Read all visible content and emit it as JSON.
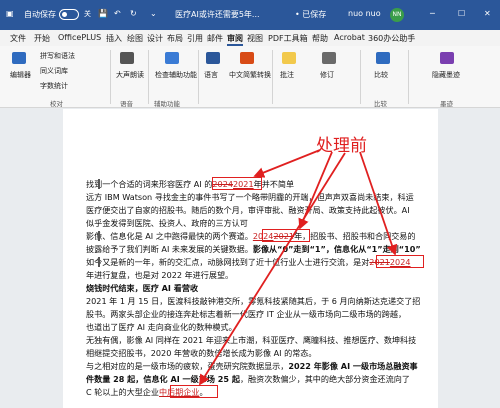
{
  "titlebar": {
    "autosave_label": "自动保存",
    "toggle_state": "关",
    "doc_title": "医疗AI或许还需要5年...",
    "saved_status": "• 已保存",
    "user_name": "nuo nuo",
    "user_initials": "NN"
  },
  "menu": [
    "文件",
    "开始",
    "OfficePLUS",
    "插入",
    "绘图",
    "设计",
    "布局",
    "引用",
    "邮件",
    "审阅",
    "视图",
    "PDF工具箱",
    "帮助",
    "Acrobat",
    "360办公助手"
  ],
  "ribbon": {
    "editor": "编辑器",
    "spelling": "拼写和语法",
    "synonyms": "同义词库",
    "wordcount": "字数统计",
    "proofing_group": "校对",
    "read_aloud": "大声朗读",
    "voice_group": "语音",
    "accessibility": "检查辅助功能",
    "accessibility_group": "辅助功能",
    "language": "语言",
    "chinese": "中文简繁转换",
    "comments": "批注",
    "tracking": "修订",
    "compare": "比较",
    "compare_group": "比较",
    "hide_ink": "隐藏墨迹",
    "ink_group": "墨迹"
  },
  "annotation": "处理前",
  "doc": {
    "l1a": "找到一个合适的词来形容医疗 AI 的",
    "l1_del": "2024",
    "l1_ins": "2021",
    "l1b": "年并不简单",
    "l2": "远方 IBM Watson 寻找金主的事件书写了一个略带阴霾的开端，但声声双喜尚未结束，科运",
    "l3": "医疗便交出了自家的招股书。随后的数个月，审评审批、融资开局、政策支持此起彼伏。AI",
    "l4": "似乎金发得到医院、投资人、政府的三方认可",
    "l5a": "影像、信息化是 AI 之中跑得最快的两个赛道。",
    "l5_ins": "2024",
    "l5_del": "2021",
    "l5b": "年，招股书、招股书和合同交易的",
    "l6a": "披露给予了我们判断 AI 未来发展的关键数据。",
    "l6b": "影像从“0”走到“1”，信息化从“1”走到“10”",
    "l7a": "如今又是新的一年，新的交汇点，动脉网找到了近十位行业人士进行交流，是对",
    "l7_del": "2021",
    "l7_ins": "2024",
    "l8": "年进行复盘，也是对 2022 年进行展望。",
    "l9": "烧钱时代结束，医疗 AI 看营收",
    "l10": "2021 年 1 月 15 日，医渡科技敲钟港交所，零氪科技紧随其后，于 6 月向纳斯达克递交了招",
    "l11": "股书。两家头部企业的接连奔赴标志着新一代医疗 IT 企业从一级市场向二级市场的跨越，",
    "l12": "也道出了医疗 AI 走向商业化的数种模式。",
    "l13": "无独有偶，影像 AI 同样在 2021 年迎来上市潮，科亚医疗、鹰瞳科技、推想医疗、数坤科技",
    "l14": "相继提交招股书，2020 年营收的数倍增长成为影像 AI 的常态。",
    "l15a": "与之相对应的是一级市场的疲软，蛋壳研究院数据显示，",
    "l15b": "2022 年影像 AI 一级市场总融资事",
    "l16a": "件数量 28 起，信息化 AI 一级市场 25 起",
    "l16b": "，融资次数偏少，其中的绝大部分资金还流向了",
    "l17a": "C 轮以上的大型企业",
    "l17_ins": "中后期企业",
    "l17b": "。"
  }
}
